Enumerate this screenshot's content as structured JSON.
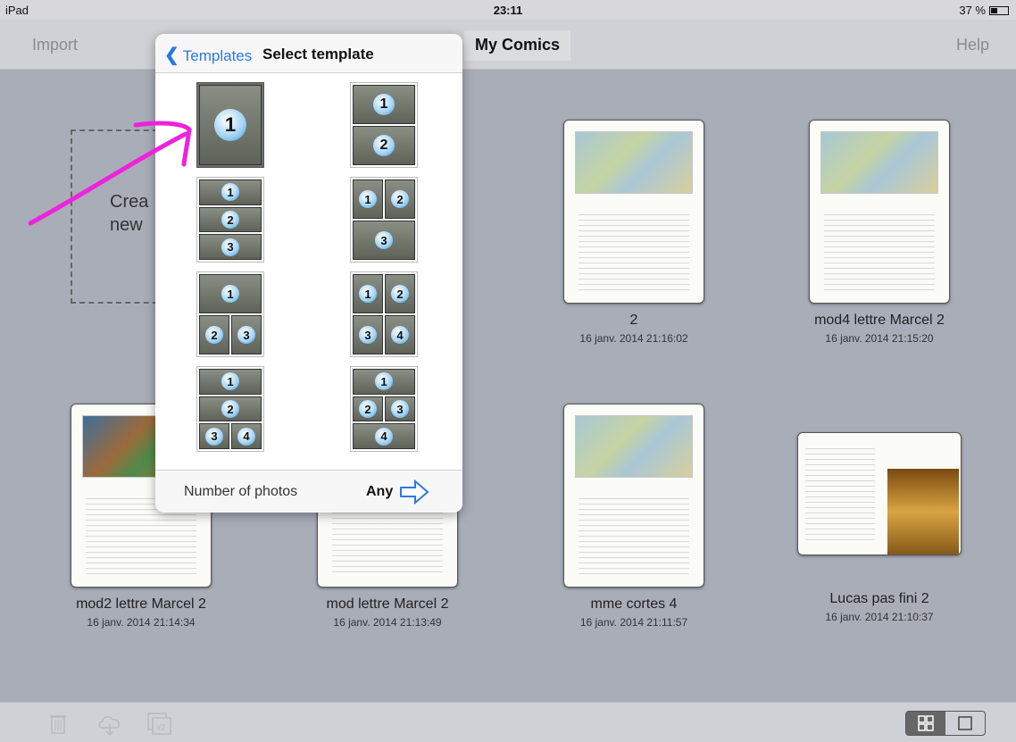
{
  "status": {
    "device": "iPad",
    "time": "23:11",
    "battery": "37 %"
  },
  "nav": {
    "import_label": "Import",
    "title": "My Comics",
    "help_label": "Help"
  },
  "create_label": "Crea\nnew",
  "comics": [
    {
      "name": "2",
      "date": "16 janv. 2014 21:16:02"
    },
    {
      "name": "mod4 lettre Marcel 2",
      "date": "16 janv. 2014 21:15:20"
    },
    {
      "name": "mod2 lettre Marcel 2",
      "date": "16 janv. 2014 21:14:34"
    },
    {
      "name": "mod lettre Marcel  2",
      "date": "16 janv. 2014 21:13:49"
    },
    {
      "name": "mme cortes 4",
      "date": "16 janv. 2014 21:11:57"
    },
    {
      "name": "Lucas pas fini 2",
      "date": "16 janv. 2014 21:10:37"
    }
  ],
  "popover": {
    "back_label": "Templates",
    "title": "Select template",
    "templates": [
      {
        "layout": [
          [
            "1"
          ]
        ]
      },
      {
        "layout": [
          [
            "1"
          ],
          [
            "2"
          ]
        ]
      },
      {
        "layout": [
          [
            "1"
          ],
          [
            "2"
          ],
          [
            "3"
          ]
        ]
      },
      {
        "layout": [
          [
            "1",
            "2"
          ],
          [
            "3"
          ]
        ]
      },
      {
        "layout": [
          [
            "1"
          ],
          [
            "2",
            "3"
          ]
        ]
      },
      {
        "layout": [
          [
            "1",
            "2"
          ],
          [
            "3",
            "4"
          ]
        ]
      },
      {
        "layout": [
          [
            "1"
          ],
          [
            "2"
          ],
          [
            "3",
            "4"
          ]
        ]
      },
      {
        "layout": [
          [
            "1"
          ],
          [
            "2",
            "3"
          ],
          [
            "4"
          ]
        ]
      }
    ],
    "footer_label": "Number of photos",
    "footer_value": "Any"
  },
  "toolbar": {
    "trash_icon": "trash-icon",
    "cloud_icon": "cloud-download-icon",
    "duplicate_icon": "duplicate-x2-icon",
    "duplicate_label": "x2"
  },
  "colors": {
    "accent": "#2a7ae2",
    "annotation": "#ee22dd",
    "background": "#a9adb8"
  }
}
